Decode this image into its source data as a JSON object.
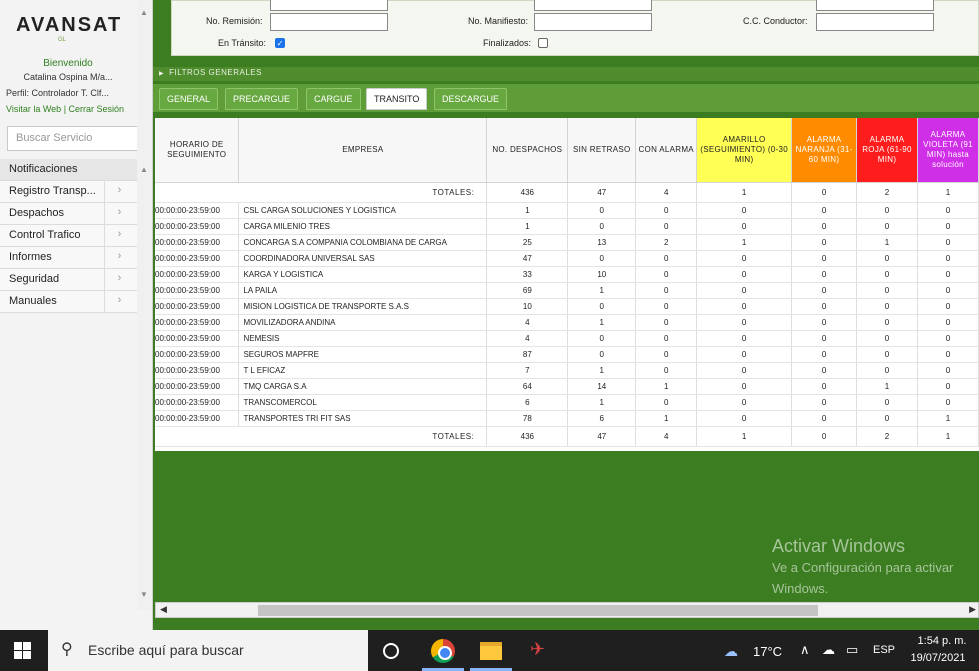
{
  "sidebar": {
    "logo": "AVANSAT",
    "logo_sub": "GL",
    "welcome": "Bienvenido",
    "user": "Catalina Ospina M/a...",
    "profile": "Perfil: Controlador T. Clf...",
    "visit_web": "Visitar la Web",
    "separator": " | ",
    "logout": "Cerrar Sesión",
    "search_placeholder": "Buscar Servicio",
    "menu": [
      "Notificaciones",
      "Registro Transp...",
      "Despachos",
      "Control Trafico",
      "Informes",
      "Seguridad",
      "Manuales"
    ]
  },
  "filters": {
    "remision_label": "No. Remisión:",
    "manifiesto_label": "No. Manifiesto:",
    "conductor_label": "C.C. Conductor:",
    "en_transito_label": "En Tránsito:",
    "en_transito_checked": true,
    "finalizados_label": "Finalizados:",
    "finalizados_checked": false,
    "general_label": "FILTROS GENERALES"
  },
  "tabs": [
    "GENERAL",
    "PRECARGUE",
    "CARGUE",
    "TRANSITO",
    "DESCARGUE"
  ],
  "active_tab": "TRANSITO",
  "table": {
    "headers": [
      "HORARIO DE SEGUIMIENTO",
      "EMPRESA",
      "NO. DESPACHOS",
      "SIN RETRASO",
      "CON ALARMA",
      "AMARILLO (SEGUIMIENTO) (0-30 MIN)",
      "ALARMA NARANJA (31-60 MIN)",
      "ALARMA ROJA (61-90 MIN)",
      "ALARMA VIOLETA (91 MIN) hasta solución"
    ],
    "header_colors": {
      "amarillo": "#ffff55",
      "naranja": "#ff8c00",
      "roja": "#ff1c1c",
      "violeta": "#d02fe8"
    },
    "totals_label": "TOTALES:",
    "totals": [
      "436",
      "47",
      "4",
      "1",
      "0",
      "2",
      "1"
    ],
    "rows": [
      [
        "00:00:00-23:59:00",
        "CSL CARGA SOLUCIONES Y LOGISTICA",
        "1",
        "0",
        "0",
        "0",
        "0",
        "0",
        "0"
      ],
      [
        "00:00:00-23:59:00",
        "CARGA MILENIO TRES",
        "1",
        "0",
        "0",
        "0",
        "0",
        "0",
        "0"
      ],
      [
        "00:00:00-23:59:00",
        "CONCARGA S.A COMPANIA COLOMBIANA DE CARGA",
        "25",
        "13",
        "2",
        "1",
        "0",
        "1",
        "0"
      ],
      [
        "00:00:00-23:59:00",
        "COORDINADORA UNIVERSAL SAS",
        "47",
        "0",
        "0",
        "0",
        "0",
        "0",
        "0"
      ],
      [
        "00:00:00-23:59:00",
        "KARGA Y LOGISTICA",
        "33",
        "10",
        "0",
        "0",
        "0",
        "0",
        "0"
      ],
      [
        "00:00:00-23:59:00",
        "LA PAILA",
        "69",
        "1",
        "0",
        "0",
        "0",
        "0",
        "0"
      ],
      [
        "00:00:00-23:59:00",
        "MISION LOGISTICA DE TRANSPORTE S.A.S",
        "10",
        "0",
        "0",
        "0",
        "0",
        "0",
        "0"
      ],
      [
        "00:00:00-23:59:00",
        "MOVILIZADORA ANDINA",
        "4",
        "1",
        "0",
        "0",
        "0",
        "0",
        "0"
      ],
      [
        "00:00:00-23:59:00",
        "NEMESIS",
        "4",
        "0",
        "0",
        "0",
        "0",
        "0",
        "0"
      ],
      [
        "00:00:00-23:59:00",
        "SEGUROS MAPFRE",
        "87",
        "0",
        "0",
        "0",
        "0",
        "0",
        "0"
      ],
      [
        "00:00:00-23:59:00",
        "T L EFICAZ",
        "7",
        "1",
        "0",
        "0",
        "0",
        "0",
        "0"
      ],
      [
        "00:00:00-23:59:00",
        "TMQ CARGA S.A",
        "64",
        "14",
        "1",
        "0",
        "0",
        "1",
        "0"
      ],
      [
        "00:00:00-23:59:00",
        "TRANSCOMERCOL",
        "6",
        "1",
        "0",
        "0",
        "0",
        "0",
        "0"
      ],
      [
        "00:00:00-23:59:00",
        "TRANSPORTES TRI FIT SAS",
        "78",
        "6",
        "1",
        "0",
        "0",
        "0",
        "1"
      ]
    ]
  },
  "watermark": {
    "title": "Activar Windows",
    "subtitle": "Ve a Configuración para activar Windows."
  },
  "taskbar": {
    "search_placeholder": "Escribe aquí para buscar",
    "temperature": "17°C",
    "language": "ESP",
    "time": "1:54 p. m.",
    "date": "19/07/2021"
  }
}
